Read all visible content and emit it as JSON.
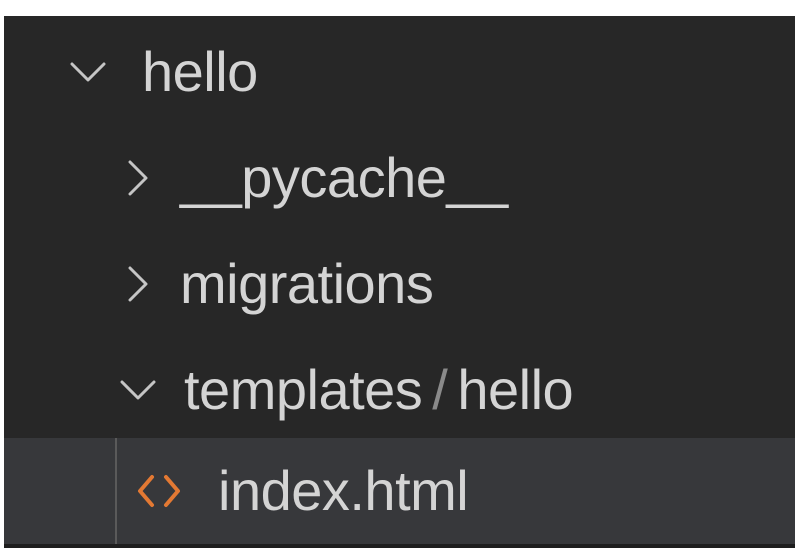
{
  "explorer": {
    "folder_hello": {
      "label": "hello",
      "expanded": true
    },
    "folder_pycache": {
      "label": "__pycache__",
      "expanded": false
    },
    "folder_migrations": {
      "label": "migrations",
      "expanded": false
    },
    "folder_templates": {
      "label": "templates",
      "separator": "/",
      "sublabel": "hello",
      "expanded": true
    },
    "file_index": {
      "label": "index.html",
      "icon": "html-code-icon",
      "icon_color": "#e37933",
      "selected": true
    }
  },
  "colors": {
    "background": "#272727",
    "selected_row": "#37383b",
    "text": "#d4d4d4"
  }
}
